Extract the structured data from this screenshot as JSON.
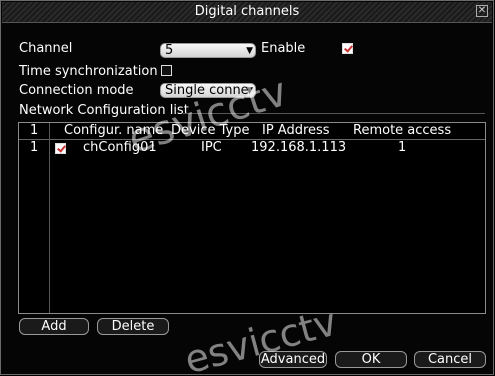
{
  "window": {
    "title": "Digital channels"
  },
  "form": {
    "channel_label": "Channel",
    "channel_value": "5",
    "enable_label": "Enable",
    "enable_checked": true,
    "time_sync_label": "Time synchronization",
    "time_sync_checked": false,
    "connection_mode_label": "Connection mode",
    "connection_mode_value": "Single conne",
    "network_list_label": "Network Configuration list"
  },
  "table": {
    "columns": [
      "1",
      "Configur. name",
      "Device Type",
      "IP Address",
      "Remote access"
    ],
    "rows": [
      {
        "index": "1",
        "checked": true,
        "config_name": "chConfig01",
        "device_type": "IPC",
        "ip_address": "192.168.1.113",
        "remote_access": "1"
      }
    ]
  },
  "buttons": {
    "add": "Add",
    "delete": "Delete",
    "advanced": "Advanced",
    "ok": "OK",
    "cancel": "Cancel"
  },
  "watermark": {
    "text": "esvicctv"
  }
}
